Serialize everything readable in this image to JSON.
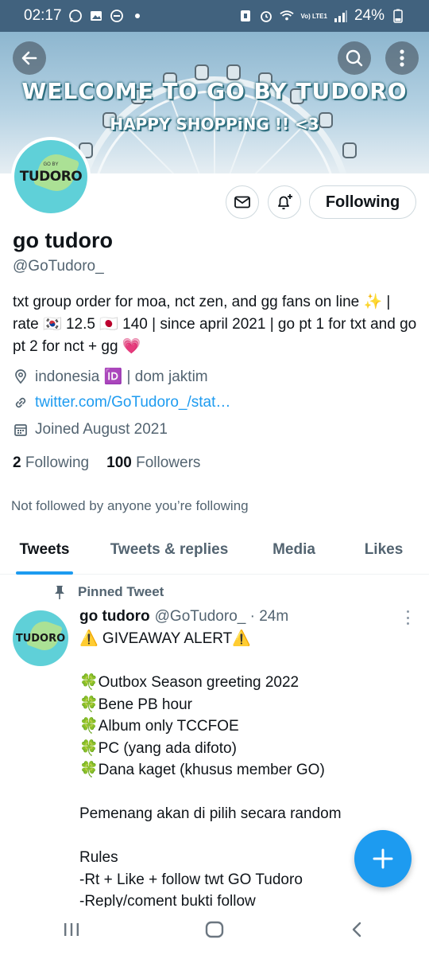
{
  "status_bar": {
    "time": "02:17",
    "battery": "24%",
    "network": "Vo) LTE1"
  },
  "banner": {
    "title": "WELCOME TO GO BY TUDORO",
    "subtitle": "HAPPY SHOPPiNG !! <3"
  },
  "avatar_text": "TUDORO",
  "avatar_small_text": "GO BY",
  "profile": {
    "following_button": "Following",
    "name": "go tudoro",
    "handle": "@GoTudoro_",
    "bio": "txt group order for moa, nct zen, and gg fans on line ✨  | rate 🇰🇷 12.5  🇯🇵 140 | since april 2021 | go pt 1 for txt and go pt 2 for nct + gg 💗",
    "location": "indonesia 🆔 | dom jaktim",
    "website": "twitter.com/GoTudoro_/stat…",
    "joined": "Joined August 2021",
    "following_count": "2",
    "following_label": "Following",
    "followers_count": "100",
    "followers_label": "Followers",
    "not_followed": "Not followed by anyone you’re following"
  },
  "tabs": [
    {
      "label": "Tweets"
    },
    {
      "label": "Tweets & replies"
    },
    {
      "label": "Media"
    },
    {
      "label": "Likes"
    }
  ],
  "tweet": {
    "pinned_label": "Pinned Tweet",
    "name": "go tudoro",
    "meta": "@GoTudoro_ · 24m",
    "body": "⚠️ GIVEAWAY ALERT⚠️\n\n🍀Outbox Season greeting 2022\n🍀Bene PB hour\n🍀Album only TCCFOE\n🍀PC (yang ada difoto)\n🍀Dana kaget (khusus member GO)\n\nPemenang akan di pilih secara random\n\nRules\n-Rt + Like + follow twt GO Tudoro\n-Reply/coment bukti follow"
  },
  "colors": {
    "accent": "#1d9bf0",
    "status_bar": "#41627e",
    "avatar_bg": "#5fd0d8"
  }
}
